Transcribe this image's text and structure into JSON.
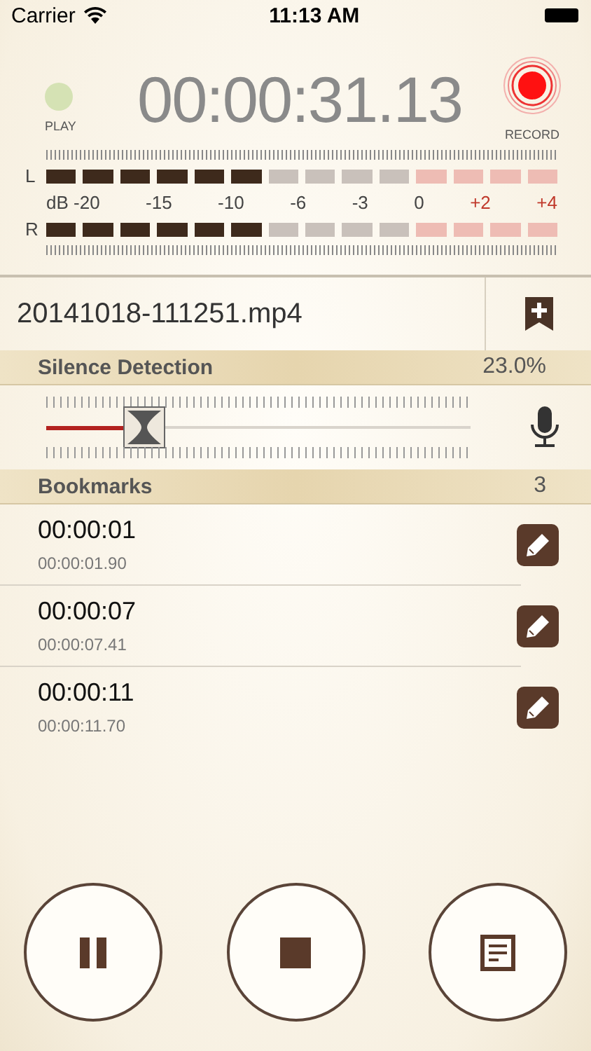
{
  "status_bar": {
    "carrier": "Carrier",
    "time": "11:13 AM"
  },
  "transport": {
    "play": {
      "label": "PLAY",
      "on": false
    },
    "timer": "00:00:31.13",
    "record": {
      "label": "RECORD",
      "on": true
    }
  },
  "meter": {
    "channels": [
      {
        "label": "L",
        "level": 0.43
      },
      {
        "label": "R",
        "level": 0.43
      }
    ],
    "scale": [
      {
        "text": "dB -20",
        "kind": "normal"
      },
      {
        "text": "-15",
        "kind": "normal"
      },
      {
        "text": "-10",
        "kind": "normal"
      },
      {
        "text": "-6",
        "kind": "normal"
      },
      {
        "text": "-3",
        "kind": "normal"
      },
      {
        "text": "0",
        "kind": "normal"
      },
      {
        "text": "+2",
        "kind": "peak"
      },
      {
        "text": "+4",
        "kind": "peak"
      }
    ]
  },
  "file": {
    "name": "20141018-111251.mp4"
  },
  "silence_detection": {
    "title": "Silence Detection",
    "value": "23.0%",
    "level": 0.23
  },
  "bookmarks": {
    "title": "Bookmarks",
    "count": "3",
    "items": [
      {
        "time": "00:00:01",
        "precise": "00:00:01.90"
      },
      {
        "time": "00:00:07",
        "precise": "00:00:07.41"
      },
      {
        "time": "00:00:11",
        "precise": "00:00:11.70"
      }
    ]
  },
  "controls": [
    {
      "kind": "pause"
    },
    {
      "kind": "stop"
    },
    {
      "kind": "notes"
    }
  ]
}
